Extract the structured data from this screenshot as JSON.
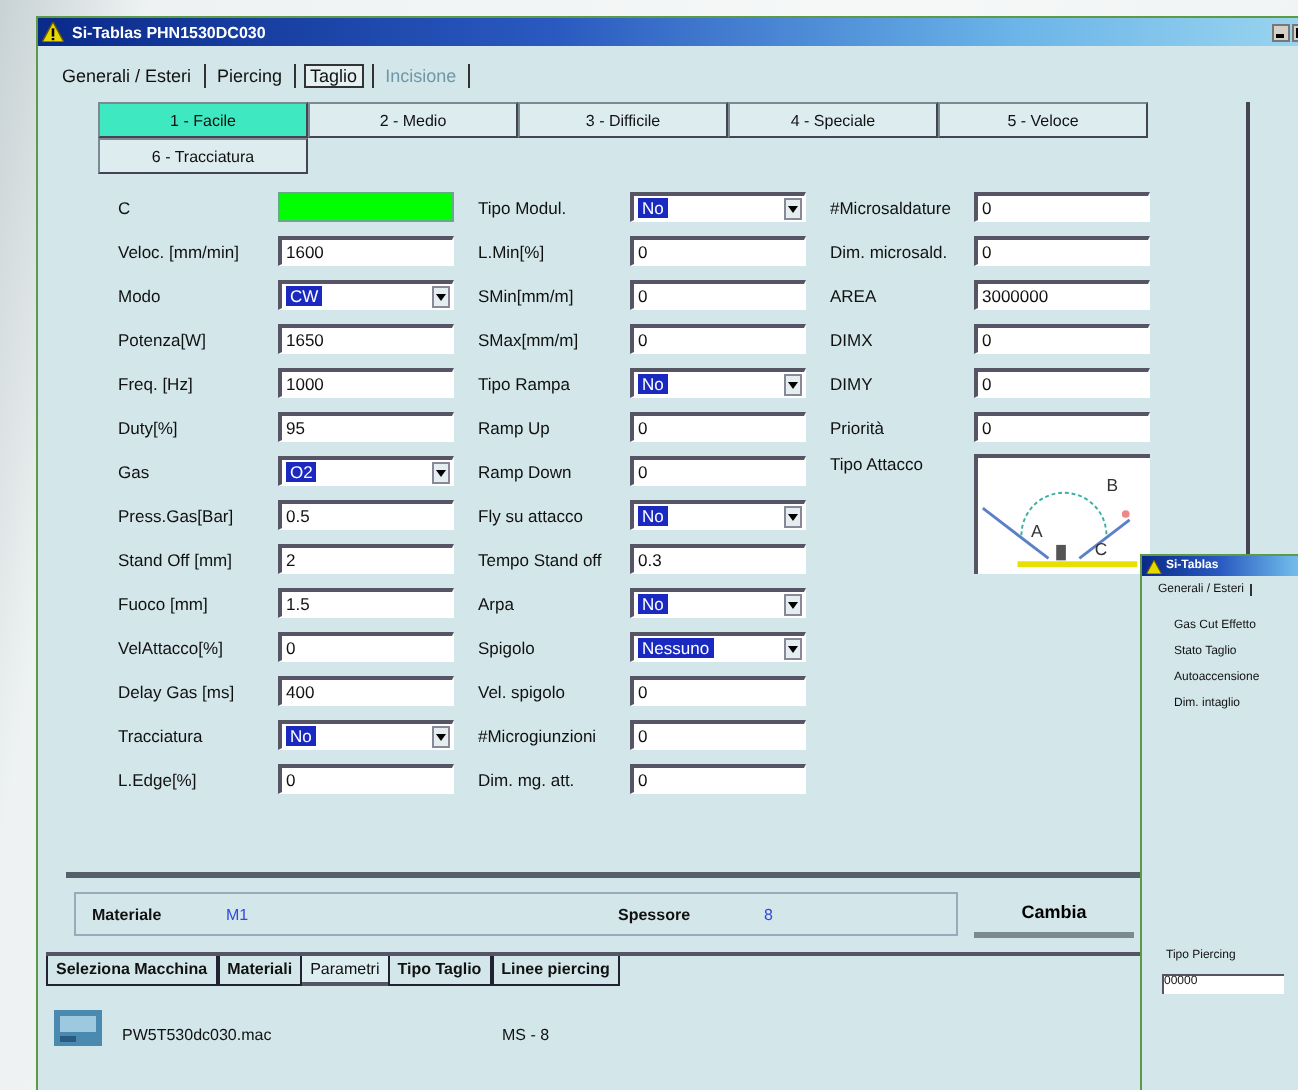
{
  "window": {
    "title": "Si-Tablas   PHN1530DC030"
  },
  "tabs": [
    {
      "label": "Generali / Esteri",
      "selected": false,
      "disabled": false
    },
    {
      "label": "Piercing",
      "selected": false,
      "disabled": false
    },
    {
      "label": "Taglio",
      "selected": true,
      "disabled": false
    },
    {
      "label": "Incisione",
      "selected": false,
      "disabled": true
    }
  ],
  "subtabs": [
    {
      "label": "1 - Facile",
      "selected": true
    },
    {
      "label": "2 - Medio",
      "selected": false
    },
    {
      "label": "3 - Difficile",
      "selected": false
    },
    {
      "label": "4 - Speciale",
      "selected": false
    },
    {
      "label": "5 - Veloce",
      "selected": false
    },
    {
      "label": "6 - Tracciatura",
      "selected": false
    }
  ],
  "columns": [
    [
      {
        "label": "C",
        "kind": "color",
        "color": "#00ff00"
      },
      {
        "label": "Veloc. [mm/min]",
        "kind": "text",
        "value": "1600"
      },
      {
        "label": "Modo",
        "kind": "combo",
        "value": "CW"
      },
      {
        "label": "Potenza[W]",
        "kind": "text",
        "value": "1650"
      },
      {
        "label": "Freq. [Hz]",
        "kind": "text",
        "value": "1000"
      },
      {
        "label": "Duty[%]",
        "kind": "text",
        "value": "95"
      },
      {
        "label": "Gas",
        "kind": "combo",
        "value": "O2"
      },
      {
        "label": "Press.Gas[Bar]",
        "kind": "text",
        "value": "0.5"
      },
      {
        "label": "Stand Off [mm]",
        "kind": "text",
        "value": "2"
      },
      {
        "label": "Fuoco [mm]",
        "kind": "text",
        "value": "1.5"
      },
      {
        "label": "VelAttacco[%]",
        "kind": "text",
        "value": "0"
      },
      {
        "label": "Delay Gas [ms]",
        "kind": "text",
        "value": "400"
      },
      {
        "label": "Tracciatura",
        "kind": "combo",
        "value": "No"
      },
      {
        "label": "L.Edge[%]",
        "kind": "text",
        "value": "0"
      }
    ],
    [
      {
        "label": "Tipo Modul.",
        "kind": "combo",
        "value": "No"
      },
      {
        "label": "L.Min[%]",
        "kind": "text",
        "value": "0"
      },
      {
        "label": "SMin[mm/m]",
        "kind": "text",
        "value": "0"
      },
      {
        "label": "SMax[mm/m]",
        "kind": "text",
        "value": "0"
      },
      {
        "label": "Tipo Rampa",
        "kind": "combo",
        "value": "No"
      },
      {
        "label": "Ramp Up",
        "kind": "text",
        "value": "0"
      },
      {
        "label": "Ramp Down",
        "kind": "text",
        "value": "0"
      },
      {
        "label": "Fly su attacco",
        "kind": "combo",
        "value": "No"
      },
      {
        "label": "Tempo Stand off",
        "kind": "text",
        "value": "0.3"
      },
      {
        "label": "Arpa",
        "kind": "combo",
        "value": "No"
      },
      {
        "label": "Spigolo",
        "kind": "combo",
        "value": "Nessuno"
      },
      {
        "label": "Vel. spigolo",
        "kind": "text",
        "value": "0"
      },
      {
        "label": "#Microgiunzioni",
        "kind": "text",
        "value": "0"
      },
      {
        "label": "Dim. mg. att.",
        "kind": "text",
        "value": "0"
      }
    ],
    [
      {
        "label": "#Microsaldature",
        "kind": "text",
        "value": "0"
      },
      {
        "label": "Dim. microsald.",
        "kind": "text",
        "value": "0"
      },
      {
        "label": "AREA",
        "kind": "text",
        "value": "3000000"
      },
      {
        "label": "DIMX",
        "kind": "text",
        "value": "0"
      },
      {
        "label": "DIMY",
        "kind": "text",
        "value": "0"
      },
      {
        "label": "Priorità",
        "kind": "text",
        "value": "0"
      },
      {
        "label": "Tipo Attacco",
        "kind": "picture",
        "marks": [
          "A",
          "B",
          "C"
        ]
      }
    ]
  ],
  "material": {
    "label": "Materiale",
    "value": "M1"
  },
  "thickness": {
    "label": "Spessore",
    "value": "8"
  },
  "change_button": "Cambia",
  "bottom_tabs": [
    {
      "label": "Seleziona Macchina",
      "selected": false
    },
    {
      "label": "Materiali",
      "selected": false
    },
    {
      "label": "Parametri",
      "selected": true
    },
    {
      "label": "Tipo Taglio",
      "selected": false
    },
    {
      "label": "Linee piercing",
      "selected": false
    }
  ],
  "file": {
    "name": "PW5T530dc030.mac",
    "code": "MS - 8"
  },
  "second_window": {
    "title": "Si-Tablas",
    "tab": "Generali / Esteri",
    "labels": [
      "Gas Cut Effetto",
      "Stato Taglio",
      "Autoaccensione",
      "Dim. intaglio"
    ],
    "piercing_label": "Tipo Piercing",
    "piercing_value": "00000"
  }
}
